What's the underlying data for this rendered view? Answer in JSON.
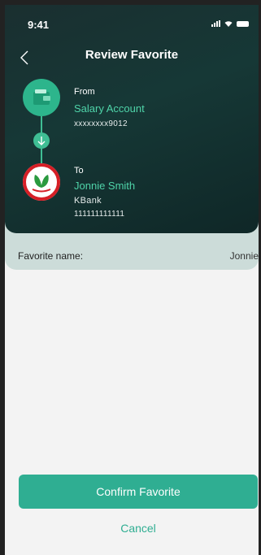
{
  "status_bar": {
    "time": "9:41"
  },
  "header": {
    "title": "Review Favorite"
  },
  "from": {
    "label": "From",
    "account_name": "Salary Account",
    "account_number": "xxxxxxxx9012",
    "icon": "wallet-icon"
  },
  "to": {
    "label": "To",
    "recipient_name": "Jonnie Smith",
    "bank": "KBank",
    "account_number": "111111111111",
    "icon": "kbank-logo"
  },
  "favorite": {
    "label": "Favorite name:",
    "value": "Jonnie"
  },
  "actions": {
    "confirm_label": "Confirm Favorite",
    "cancel_label": "Cancel"
  },
  "colors": {
    "accent": "#2fae92",
    "header_bg": "#163836",
    "panel_bg": "#ccdcd9"
  }
}
